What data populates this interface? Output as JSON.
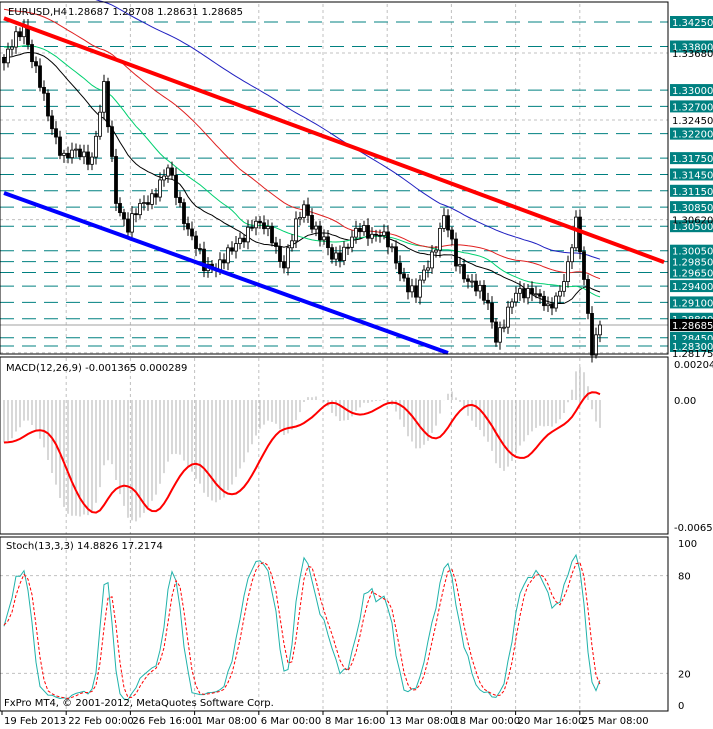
{
  "header": {
    "symbol": "EURUSD,H4",
    "ohlc": "1.28687 1.28708 1.28631 1.28685"
  },
  "copyright": "FxPro MT4, © 2001-2012, MetaQuotes Software Corp.",
  "colors": {
    "bg": "#ffffff",
    "level": "#008080",
    "trend_red": "#ff0000",
    "trend_blue": "#0000ff",
    "ma_black": "#000000",
    "ma_green": "#00d070",
    "ma_red": "#e02020",
    "ma_blue": "#2020c0",
    "stoch_main": "#20b2aa",
    "stoch_signal": "#ff0000",
    "macd_hist": "#b0b0b0"
  },
  "chart_data": [
    {
      "type": "candlestick",
      "title": "EURUSD,H4",
      "ylim": [
        1.28175,
        1.3455
      ],
      "levels": [
        "1.34250",
        "1.33800",
        "1.33000",
        "1.32700",
        "1.32200",
        "1.31750",
        "1.31450",
        "1.31150",
        "1.30850",
        "1.30500",
        "1.30050",
        "1.29850",
        "1.29650",
        "1.29400",
        "1.29100",
        "1.28800",
        "1.28450",
        "1.28300"
      ],
      "axis_ticks": [
        "1.33680",
        "1.32450",
        "1.30620",
        "1.28175"
      ],
      "current_price": "1.28685",
      "close_path": [
        [
          0,
          1.335
        ],
        [
          5,
          1.342
        ],
        [
          11,
          1.325
        ],
        [
          15,
          1.318
        ],
        [
          22,
          1.318
        ],
        [
          25,
          1.33
        ],
        [
          28,
          1.31
        ],
        [
          31,
          1.305
        ],
        [
          41,
          1.315
        ],
        [
          50,
          1.297
        ],
        [
          57,
          1.3
        ],
        [
          62,
          1.306
        ],
        [
          67,
          1.303
        ],
        [
          70,
          1.298
        ],
        [
          75,
          1.309
        ],
        [
          79,
          1.303
        ],
        [
          82,
          1.299
        ],
        [
          89,
          1.304
        ],
        [
          94,
          1.304
        ],
        [
          99,
          1.297
        ],
        [
          103,
          1.292
        ],
        [
          107,
          1.3
        ],
        [
          110,
          1.307
        ],
        [
          113,
          1.298
        ],
        [
          117,
          1.295
        ],
        [
          121,
          1.29
        ],
        [
          123,
          1.285
        ],
        [
          128,
          1.292
        ],
        [
          132,
          1.294
        ],
        [
          136,
          1.289
        ],
        [
          138,
          1.292
        ],
        [
          141,
          1.298
        ],
        [
          143,
          1.305
        ],
        [
          145,
          1.295
        ],
        [
          147,
          1.283
        ],
        [
          149,
          1.2868
        ]
      ],
      "trendlines": [
        {
          "color": "red",
          "from": [
            0,
            1.3432
          ],
          "to": [
            165,
            1.2984
          ]
        },
        {
          "color": "blue",
          "from": [
            0,
            1.3111
          ],
          "to": [
            111,
            1.2817
          ]
        }
      ]
    },
    {
      "type": "line",
      "title": "MACD(12,26,9) -0.001365 0.000289",
      "ylim": [
        -0.00654,
        0.002042
      ],
      "axis_ticks": [
        "0.002042",
        "0.00",
        "-0.00654"
      ]
    },
    {
      "type": "line",
      "title": "Stoch(13,3,3) 14.8826 17.2174",
      "ylim": [
        0,
        100
      ],
      "axis_ticks": [
        "100",
        "80",
        "20",
        "0"
      ]
    }
  ],
  "x_axis": [
    "19 Feb 2013",
    "22 Feb 00:00",
    "26 Feb 16:00",
    "1 Mar 08:00",
    "6 Mar 00:00",
    "8 Mar 16:00",
    "13 Mar 08:00",
    "18 Mar 00:00",
    "20 Mar 16:00",
    "25 Mar 08:00"
  ]
}
